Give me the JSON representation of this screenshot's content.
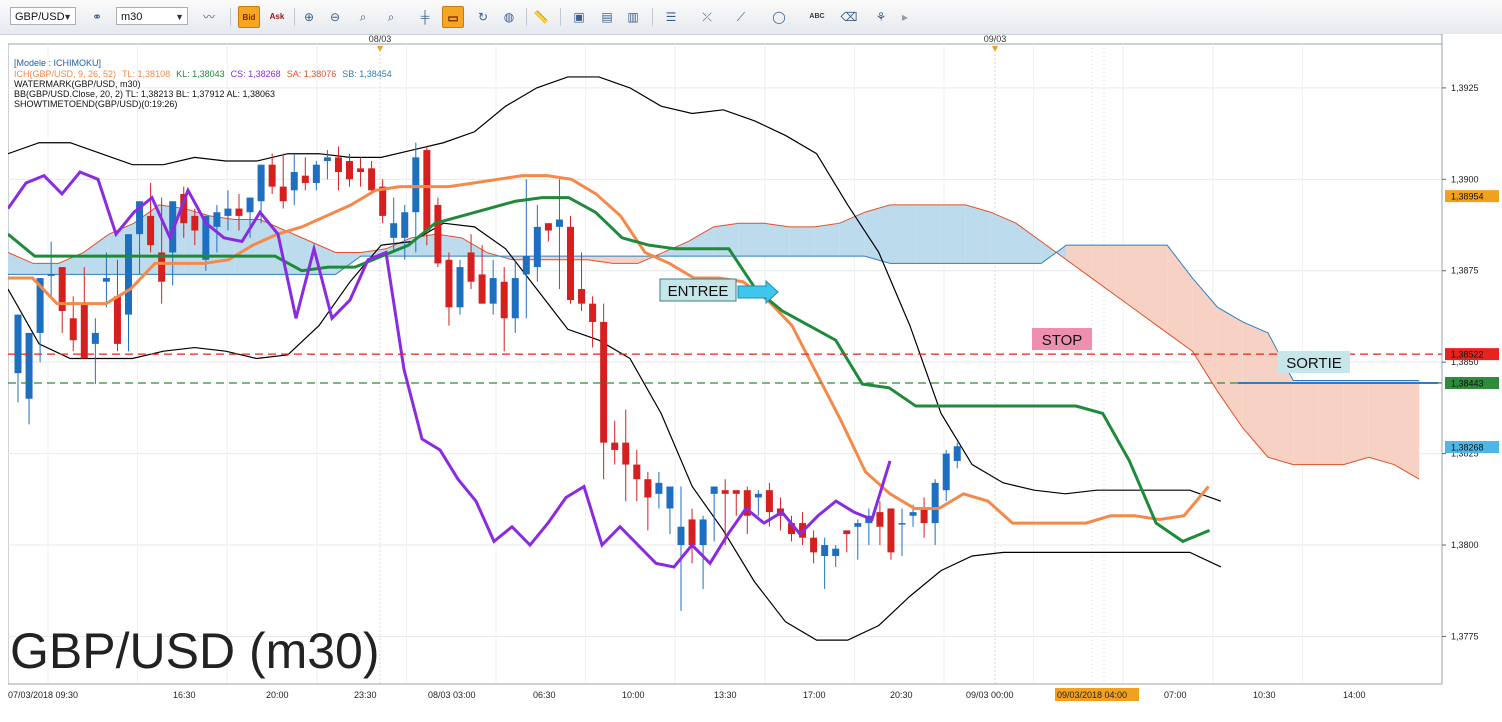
{
  "toolbar": {
    "symbol": "GBP/USD",
    "timeframe": "m30",
    "bid_label": "Bid",
    "ask_label": "Ask",
    "icons": [
      "link-icon",
      "line-chart-icon",
      "zoom-in-icon",
      "zoom-out-icon",
      "zoom-fit-icon",
      "period-separator-icon",
      "chart-window-icon",
      "refresh-icon",
      "globe-icon",
      "ruler-icon",
      "screenshot-icon",
      "list-icon",
      "drawing-tools-icon",
      "trendline-icon",
      "ellipse-icon",
      "text-abc-icon",
      "eraser-icon",
      "template-icon"
    ]
  },
  "chart": {
    "title_big": "GBP/USD (m30)",
    "legend": {
      "model": "[Modele : ICHIMOKU]",
      "ich_prefix": "ICH(GBP/USD, 9, 26, 52)",
      "tl": "TL: 1,38108",
      "kl": "KL: 1,38043",
      "cs": "CS: 1,38268",
      "sa": "SA: 1,38076",
      "sb": "SB: 1,38454",
      "watermark": "WATERMARK(GBP/USD, m30)",
      "bb": "BB(GBP/USD.Close, 20, 2)  TL: 1,38213  BL: 1,37912  AL: 1,38063",
      "showtime": "SHOWTIMETOEND(GBP/USD)(0:19:26)"
    },
    "top_dates": [
      "08/03",
      "09/03"
    ],
    "annotations": {
      "entry": "ENTREE",
      "stop": "STOP",
      "exit": "SORTIE"
    },
    "y_ticks": [
      "1,3925",
      "1,3900",
      "1,3875",
      "1,3850",
      "1,3825",
      "1,3800",
      "1,3775"
    ],
    "price_tags": [
      {
        "label": "1,38954",
        "color": "#f2a11f"
      },
      {
        "label": "1,38522",
        "color": "#e8221c"
      },
      {
        "label": "1,38443",
        "color": "#2e8b3a"
      },
      {
        "label": "1,38268",
        "color": "#4fb6e8"
      }
    ],
    "x_ticks": [
      "07/03/2018 09:30",
      "16:30",
      "20:00",
      "23:30",
      "08/03 03:00",
      "06:30",
      "10:00",
      "13:30",
      "17:00",
      "20:30",
      "09/03 00:00",
      "09/03/2018 04:00",
      "07:00",
      "10:30",
      "14:00"
    ],
    "colors": {
      "tenkan": "#f5894a",
      "kijun": "#1f8a3a",
      "chikou": "#8a2be2",
      "senkou_a": "#e0502a",
      "senkou_b": "#2b7fc0",
      "kumo_bull": "#bcdcee",
      "kumo_bear": "#f7d2c4",
      "bollinger": "#000000",
      "candle_up": "#1f6fc0",
      "candle_down": "#d62020",
      "stop_line": "#e8221c",
      "exit_line": "#2e8b3a"
    }
  },
  "chart_data": {
    "type": "candlestick",
    "symbol": "GBP/USD",
    "timeframe": "m30",
    "y_range": [
      1.3762,
      1.3937
    ],
    "levels": {
      "stop": 1.38522,
      "exit": 1.38443
    },
    "last_price": 1.38268,
    "candles": [
      {
        "o": 1.3847,
        "h": 1.386,
        "l": 1.3839,
        "c": 1.3863
      },
      {
        "o": 1.384,
        "h": 1.3855,
        "l": 1.3833,
        "c": 1.3858
      },
      {
        "o": 1.3858,
        "h": 1.3867,
        "l": 1.385,
        "c": 1.3873
      },
      {
        "o": 1.3874,
        "h": 1.3883,
        "l": 1.3868,
        "c": 1.3874
      },
      {
        "o": 1.3876,
        "h": 1.3876,
        "l": 1.3858,
        "c": 1.3864
      },
      {
        "o": 1.3862,
        "h": 1.3868,
        "l": 1.3853,
        "c": 1.3856
      },
      {
        "o": 1.3866,
        "h": 1.3876,
        "l": 1.3855,
        "c": 1.3851
      },
      {
        "o": 1.3855,
        "h": 1.3862,
        "l": 1.3844,
        "c": 1.3858
      },
      {
        "o": 1.3872,
        "h": 1.388,
        "l": 1.3865,
        "c": 1.3873
      },
      {
        "o": 1.3868,
        "h": 1.3878,
        "l": 1.3853,
        "c": 1.3855
      },
      {
        "o": 1.3863,
        "h": 1.3882,
        "l": 1.3853,
        "c": 1.3885
      },
      {
        "o": 1.3885,
        "h": 1.3891,
        "l": 1.3874,
        "c": 1.3894
      },
      {
        "o": 1.389,
        "h": 1.3899,
        "l": 1.388,
        "c": 1.3882
      },
      {
        "o": 1.388,
        "h": 1.3895,
        "l": 1.3866,
        "c": 1.3872
      },
      {
        "o": 1.388,
        "h": 1.389,
        "l": 1.3871,
        "c": 1.3894
      },
      {
        "o": 1.3896,
        "h": 1.3898,
        "l": 1.3884,
        "c": 1.3888
      },
      {
        "o": 1.389,
        "h": 1.3892,
        "l": 1.3882,
        "c": 1.3886
      },
      {
        "o": 1.3878,
        "h": 1.389,
        "l": 1.3875,
        "c": 1.389
      },
      {
        "o": 1.3887,
        "h": 1.3893,
        "l": 1.388,
        "c": 1.3891
      },
      {
        "o": 1.389,
        "h": 1.3897,
        "l": 1.3886,
        "c": 1.3892
      },
      {
        "o": 1.3892,
        "h": 1.3896,
        "l": 1.3886,
        "c": 1.389
      },
      {
        "o": 1.3891,
        "h": 1.3895,
        "l": 1.3884,
        "c": 1.3895
      },
      {
        "o": 1.3894,
        "h": 1.3903,
        "l": 1.3888,
        "c": 1.3904
      },
      {
        "o": 1.3904,
        "h": 1.3907,
        "l": 1.3896,
        "c": 1.3898
      },
      {
        "o": 1.3898,
        "h": 1.3907,
        "l": 1.3892,
        "c": 1.3894
      },
      {
        "o": 1.3897,
        "h": 1.3907,
        "l": 1.3893,
        "c": 1.3902
      },
      {
        "o": 1.3901,
        "h": 1.3906,
        "l": 1.3897,
        "c": 1.3899
      },
      {
        "o": 1.3899,
        "h": 1.3905,
        "l": 1.3897,
        "c": 1.3904
      },
      {
        "o": 1.3905,
        "h": 1.3908,
        "l": 1.39,
        "c": 1.3906
      },
      {
        "o": 1.3906,
        "h": 1.3909,
        "l": 1.3897,
        "c": 1.3902
      },
      {
        "o": 1.3905,
        "h": 1.3907,
        "l": 1.3898,
        "c": 1.39
      },
      {
        "o": 1.3903,
        "h": 1.3906,
        "l": 1.3898,
        "c": 1.3902
      },
      {
        "o": 1.3903,
        "h": 1.3905,
        "l": 1.3896,
        "c": 1.3897
      },
      {
        "o": 1.3898,
        "h": 1.39,
        "l": 1.3888,
        "c": 1.389
      },
      {
        "o": 1.3884,
        "h": 1.3895,
        "l": 1.388,
        "c": 1.3888
      },
      {
        "o": 1.3884,
        "h": 1.3893,
        "l": 1.3878,
        "c": 1.3891
      },
      {
        "o": 1.3891,
        "h": 1.391,
        "l": 1.388,
        "c": 1.3906
      },
      {
        "o": 1.3908,
        "h": 1.3909,
        "l": 1.3882,
        "c": 1.3886
      },
      {
        "o": 1.3893,
        "h": 1.3895,
        "l": 1.3876,
        "c": 1.3877
      },
      {
        "o": 1.3878,
        "h": 1.388,
        "l": 1.386,
        "c": 1.3865
      },
      {
        "o": 1.3865,
        "h": 1.3878,
        "l": 1.3863,
        "c": 1.3876
      },
      {
        "o": 1.388,
        "h": 1.3885,
        "l": 1.387,
        "c": 1.3872
      },
      {
        "o": 1.3874,
        "h": 1.3882,
        "l": 1.3866,
        "c": 1.3866
      },
      {
        "o": 1.3866,
        "h": 1.3878,
        "l": 1.3863,
        "c": 1.3873
      },
      {
        "o": 1.3872,
        "h": 1.3876,
        "l": 1.3853,
        "c": 1.3862
      },
      {
        "o": 1.3862,
        "h": 1.3878,
        "l": 1.3858,
        "c": 1.3873
      },
      {
        "o": 1.3874,
        "h": 1.39,
        "l": 1.3862,
        "c": 1.3879
      },
      {
        "o": 1.3876,
        "h": 1.3893,
        "l": 1.3872,
        "c": 1.3887
      },
      {
        "o": 1.3888,
        "h": 1.3888,
        "l": 1.3883,
        "c": 1.3886
      },
      {
        "o": 1.3887,
        "h": 1.39,
        "l": 1.387,
        "c": 1.3889
      },
      {
        "o": 1.3887,
        "h": 1.389,
        "l": 1.3866,
        "c": 1.3867
      },
      {
        "o": 1.387,
        "h": 1.388,
        "l": 1.3864,
        "c": 1.3866
      },
      {
        "o": 1.3866,
        "h": 1.3868,
        "l": 1.3854,
        "c": 1.3861
      },
      {
        "o": 1.3861,
        "h": 1.3866,
        "l": 1.3818,
        "c": 1.3828
      },
      {
        "o": 1.3828,
        "h": 1.3834,
        "l": 1.3822,
        "c": 1.3826
      },
      {
        "o": 1.3828,
        "h": 1.3837,
        "l": 1.3812,
        "c": 1.3822
      },
      {
        "o": 1.3822,
        "h": 1.3826,
        "l": 1.3812,
        "c": 1.3818
      },
      {
        "o": 1.3818,
        "h": 1.382,
        "l": 1.3804,
        "c": 1.3813
      },
      {
        "o": 1.3814,
        "h": 1.382,
        "l": 1.381,
        "c": 1.3817
      },
      {
        "o": 1.381,
        "h": 1.3816,
        "l": 1.3803,
        "c": 1.3816
      },
      {
        "o": 1.38,
        "h": 1.3816,
        "l": 1.3782,
        "c": 1.3805
      },
      {
        "o": 1.3807,
        "h": 1.381,
        "l": 1.3795,
        "c": 1.38
      },
      {
        "o": 1.38,
        "h": 1.3808,
        "l": 1.3788,
        "c": 1.3807
      },
      {
        "o": 1.3814,
        "h": 1.3816,
        "l": 1.3801,
        "c": 1.3816
      },
      {
        "o": 1.3815,
        "h": 1.3818,
        "l": 1.38,
        "c": 1.3814
      },
      {
        "o": 1.3815,
        "h": 1.3815,
        "l": 1.3808,
        "c": 1.3814
      },
      {
        "o": 1.3815,
        "h": 1.3816,
        "l": 1.3803,
        "c": 1.3808
      },
      {
        "o": 1.3813,
        "h": 1.3815,
        "l": 1.3808,
        "c": 1.3814
      },
      {
        "o": 1.3815,
        "h": 1.3817,
        "l": 1.3805,
        "c": 1.3809
      },
      {
        "o": 1.381,
        "h": 1.3813,
        "l": 1.3804,
        "c": 1.3808
      },
      {
        "o": 1.3806,
        "h": 1.3808,
        "l": 1.3801,
        "c": 1.3803
      },
      {
        "o": 1.3806,
        "h": 1.3809,
        "l": 1.38,
        "c": 1.3802
      },
      {
        "o": 1.3802,
        "h": 1.3804,
        "l": 1.3795,
        "c": 1.3798
      },
      {
        "o": 1.3797,
        "h": 1.3802,
        "l": 1.3788,
        "c": 1.38
      },
      {
        "o": 1.3797,
        "h": 1.38,
        "l": 1.3794,
        "c": 1.3799
      },
      {
        "o": 1.3804,
        "h": 1.3804,
        "l": 1.3798,
        "c": 1.3803
      },
      {
        "o": 1.3805,
        "h": 1.3807,
        "l": 1.3796,
        "c": 1.3806
      },
      {
        "o": 1.3806,
        "h": 1.381,
        "l": 1.38,
        "c": 1.3808
      },
      {
        "o": 1.3809,
        "h": 1.3812,
        "l": 1.38,
        "c": 1.3805
      },
      {
        "o": 1.381,
        "h": 1.381,
        "l": 1.3796,
        "c": 1.3798
      },
      {
        "o": 1.3806,
        "h": 1.381,
        "l": 1.3797,
        "c": 1.3806
      },
      {
        "o": 1.3808,
        "h": 1.3811,
        "l": 1.3805,
        "c": 1.3809
      },
      {
        "o": 1.381,
        "h": 1.3813,
        "l": 1.3802,
        "c": 1.3806
      },
      {
        "o": 1.3806,
        "h": 1.3818,
        "l": 1.38,
        "c": 1.3817
      },
      {
        "o": 1.3815,
        "h": 1.3826,
        "l": 1.3812,
        "c": 1.3825
      },
      {
        "o": 1.3823,
        "h": 1.3828,
        "l": 1.3821,
        "c": 1.3827
      }
    ],
    "indicators": {
      "ichimoku": {
        "tenkan": 1.38108,
        "kijun": 1.38043,
        "chikou": 1.38268,
        "senkou_a": 1.38076,
        "senkou_b": 1.38454
      },
      "bollinger": {
        "tl": 1.38213,
        "bl": 1.37912,
        "al": 1.38063
      }
    }
  }
}
